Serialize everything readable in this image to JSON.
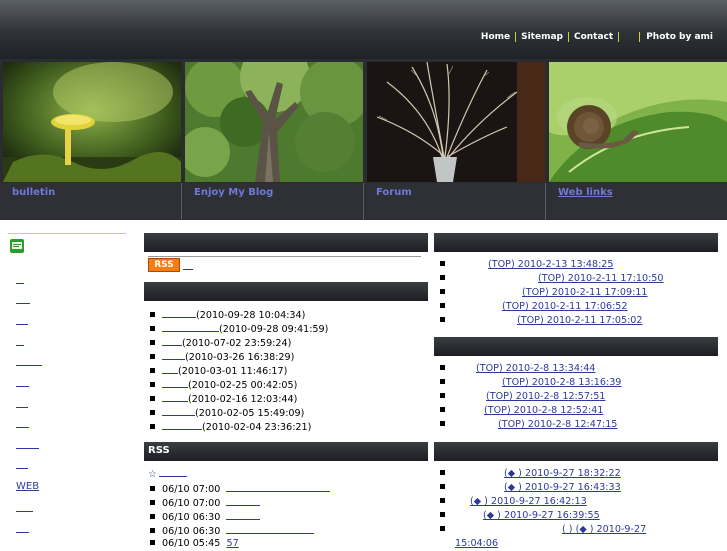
{
  "header": {
    "nav": [
      "Home",
      "Sitemap",
      "Contact"
    ],
    "photo_credit": "Photo by ami"
  },
  "features": [
    {
      "label": "bulletin",
      "image": "yellow-mushroom-photo"
    },
    {
      "label": "Enjoy My Blog",
      "image": "forest-tree-photo"
    },
    {
      "label": "Forum",
      "image": "dried-grass-photo"
    },
    {
      "label": "Web links",
      "image": "snail-on-leaf-photo"
    }
  ],
  "sidebar": {
    "icon": "green-document-icon",
    "web_label": "WEB"
  },
  "center": {
    "rss_badge": "RSS",
    "recent_entries": [
      "(2010-09-28 10:04:34)",
      "(2010-09-28 09:41:59)",
      "(2010-07-02 23:59:24)",
      "(2010-03-26 16:38:29)",
      "(2010-03-01 11:46:17)",
      "(2010-02-25 00:42:05)",
      "(2010-02-16 12:03:44)",
      "(2010-02-05 15:49:09)",
      "(2010-02-04 23:36:21)"
    ],
    "rss_title": "RSS",
    "rss_star": "☆",
    "rss_items": [
      {
        "time": "06/10 07:00"
      },
      {
        "time": "06/10 07:00"
      },
      {
        "time": "06/10 06:30"
      },
      {
        "time": "06/10 06:30"
      },
      {
        "time": "06/10 05:45",
        "extra": "57"
      }
    ]
  },
  "right": {
    "list1": [
      "(TOP)  2010-2-13 13:48:25",
      "(TOP)  2010-2-11 17:10:50",
      "(TOP)  2010-2-11 17:09:11",
      "(TOP)  2010-2-11 17:06:52",
      "(TOP)  2010-2-11 17:05:02"
    ],
    "list2": [
      "(TOP)  2010-2-8 13:34:44",
      "(TOP)  2010-2-8 13:16:39",
      "(TOP)  2010-2-8 12:57:51",
      "(TOP)  2010-2-8 12:52:41",
      "(TOP)  2010-2-8 12:47:15"
    ],
    "list3": [
      "(◆          )  2010-9-27 18:32:22",
      "(◆          )  2010-9-27 16:43:33",
      "(◆          )  2010-9-27 16:42:13",
      "(◆          )  2010-9-27 16:39:55",
      "( ) (◆          )  2010-9-27",
      "15:04:06"
    ]
  }
}
